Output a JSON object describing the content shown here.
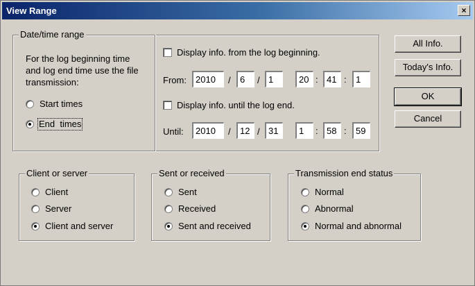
{
  "window": {
    "title": "View Range",
    "close_icon": "×"
  },
  "date_range": {
    "label": "Date/time range",
    "instructions": [
      "For the log beginning time",
      "and log end time use the file",
      "transmission:"
    ],
    "options": [
      {
        "label": "Start times",
        "selected": false
      },
      {
        "label": "End  times",
        "selected": true
      }
    ],
    "from_checkbox": {
      "label": "Display info. from the log beginning.",
      "checked": false
    },
    "from": {
      "label": "From:",
      "year": "2010",
      "month": "6",
      "day": "1",
      "hour": "20",
      "minute": "41",
      "second": "1"
    },
    "until_checkbox": {
      "label": "Display info. until the log end.",
      "checked": false
    },
    "until": {
      "label": "Until:",
      "year": "2010",
      "month": "12",
      "day": "31",
      "hour": "1",
      "minute": "58",
      "second": "59"
    },
    "date_separator": "/",
    "time_separator": ":"
  },
  "client_server": {
    "label": "Client or server",
    "options": [
      {
        "label": "Client",
        "selected": false
      },
      {
        "label": "Server",
        "selected": false
      },
      {
        "label": "Client and server",
        "selected": true
      }
    ]
  },
  "sent_received": {
    "label": "Sent or received",
    "options": [
      {
        "label": "Sent",
        "selected": false
      },
      {
        "label": "Received",
        "selected": false
      },
      {
        "label": "Sent and received",
        "selected": true
      }
    ]
  },
  "end_status": {
    "label": "Transmission end status",
    "options": [
      {
        "label": "Normal",
        "selected": false
      },
      {
        "label": "Abnormal",
        "selected": false
      },
      {
        "label": "Normal and abnormal",
        "selected": true
      }
    ]
  },
  "buttons": {
    "all_info": "All Info.",
    "todays_info": "Today's Info.",
    "ok": "OK",
    "cancel": "Cancel"
  },
  "colors": {
    "title_gradient_start": "#0a246a",
    "title_gradient_end": "#a6caf0",
    "face": "#d4d0c8"
  }
}
